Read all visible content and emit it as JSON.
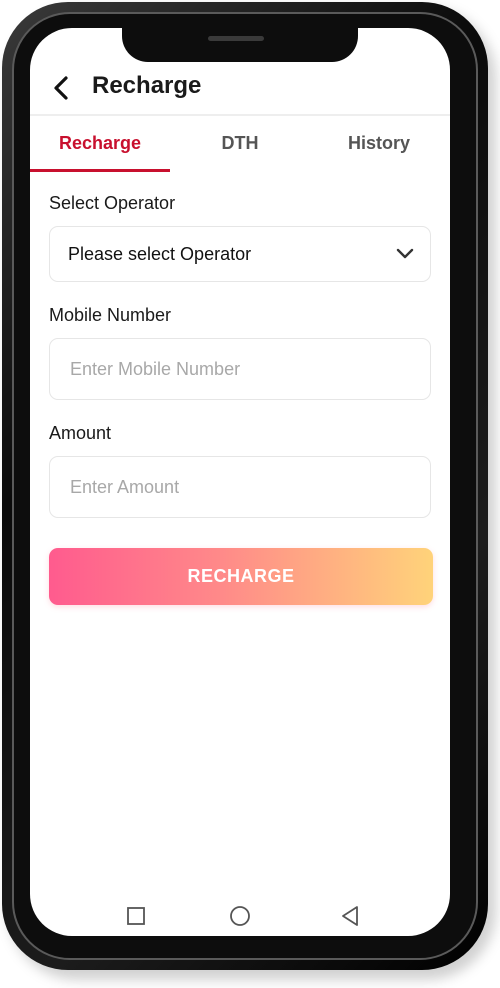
{
  "header": {
    "title": "Recharge",
    "back_icon": "chevron-left-icon"
  },
  "tabs": [
    {
      "label": "Recharge",
      "active": true
    },
    {
      "label": "DTH",
      "active": false
    },
    {
      "label": "History",
      "active": false
    }
  ],
  "form": {
    "operator": {
      "label": "Select Operator",
      "value": "Please select Operator",
      "icon": "chevron-down-icon"
    },
    "mobile": {
      "label": "Mobile Number",
      "placeholder": "Enter Mobile Number",
      "value": ""
    },
    "amount": {
      "label": "Amount",
      "placeholder": "Enter Amount",
      "value": ""
    },
    "submit_label": "RECHARGE"
  },
  "navbar": {
    "buttons": [
      "recent-apps-icon",
      "home-icon",
      "back-triangle-icon"
    ]
  },
  "colors": {
    "accent": "#c8102e",
    "button_gradient_start": "#ff5b8e",
    "button_gradient_end": "#ffd37a"
  }
}
